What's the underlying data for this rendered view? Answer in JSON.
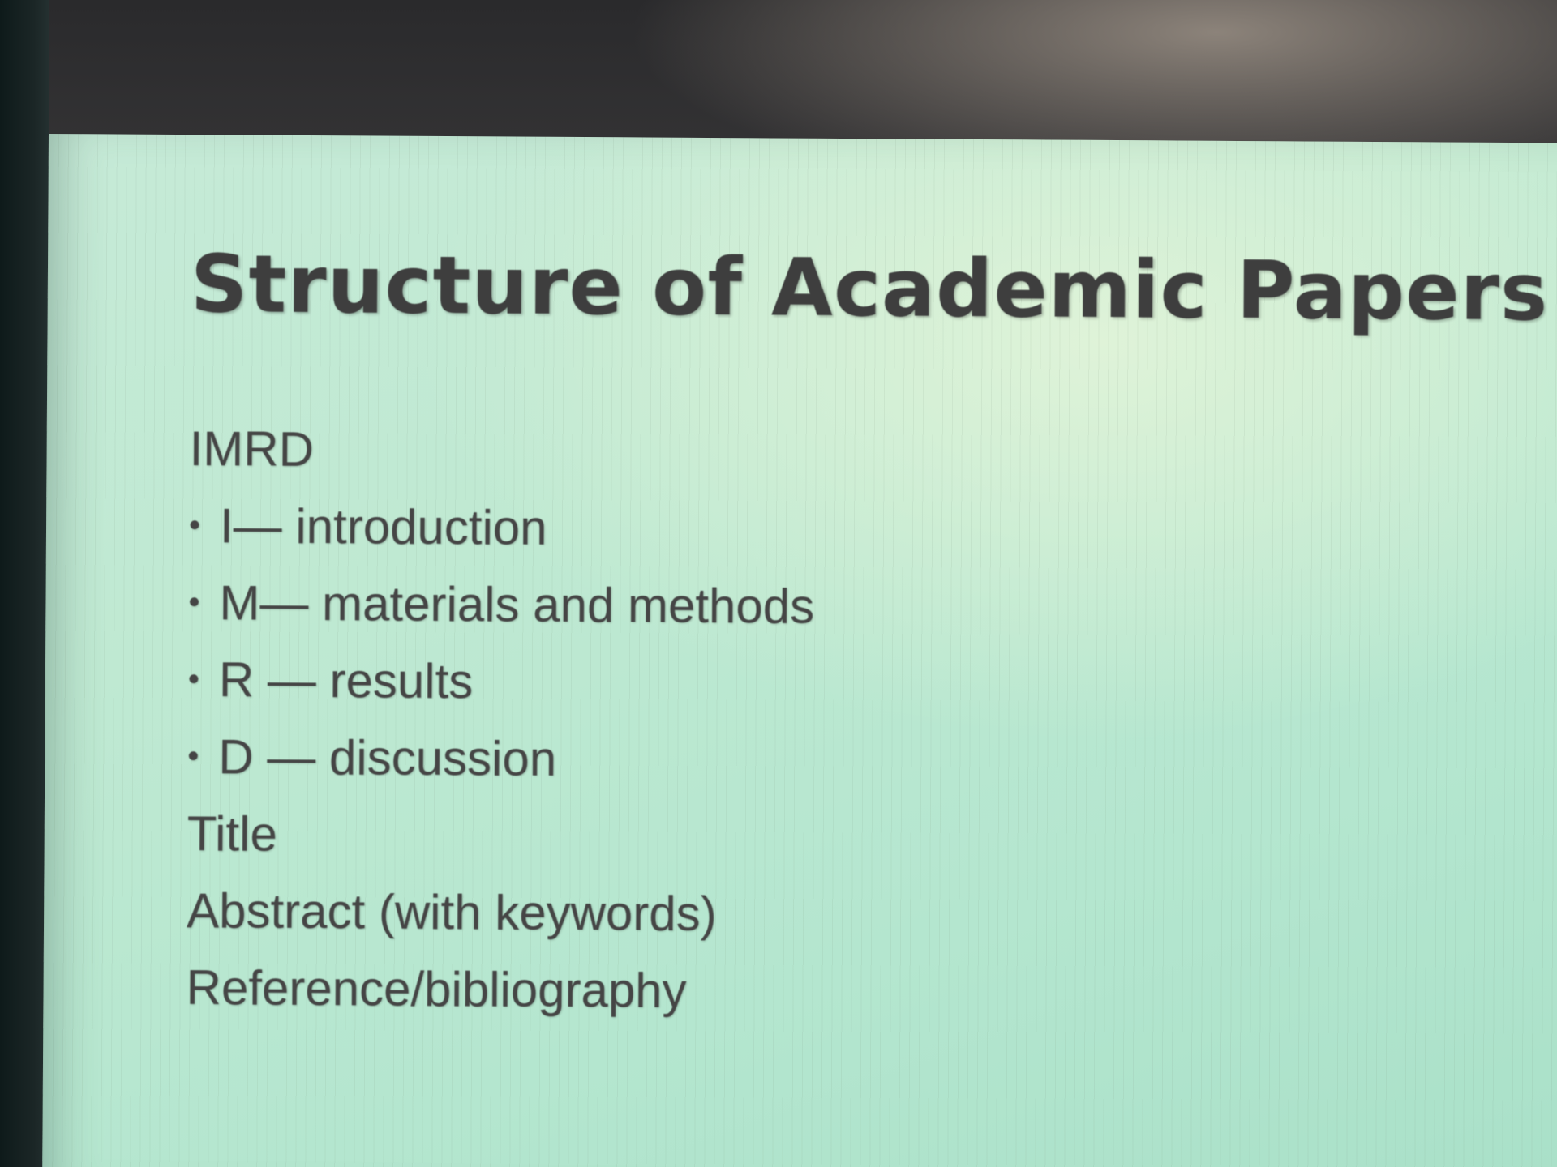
{
  "slide": {
    "title": "Structure of Academic Papers",
    "heading": "IMRD",
    "bullets": [
      "I— introduction",
      "M— materials and methods",
      "R — results",
      "D — discussion"
    ],
    "lines": [
      "Title",
      "Abstract (with keywords)",
      "Reference/bibliography"
    ],
    "bullet_glyph": "•"
  },
  "colors": {
    "slide_background": "#bfe9d2",
    "text": "#454545",
    "title": "#3e3e3e"
  }
}
